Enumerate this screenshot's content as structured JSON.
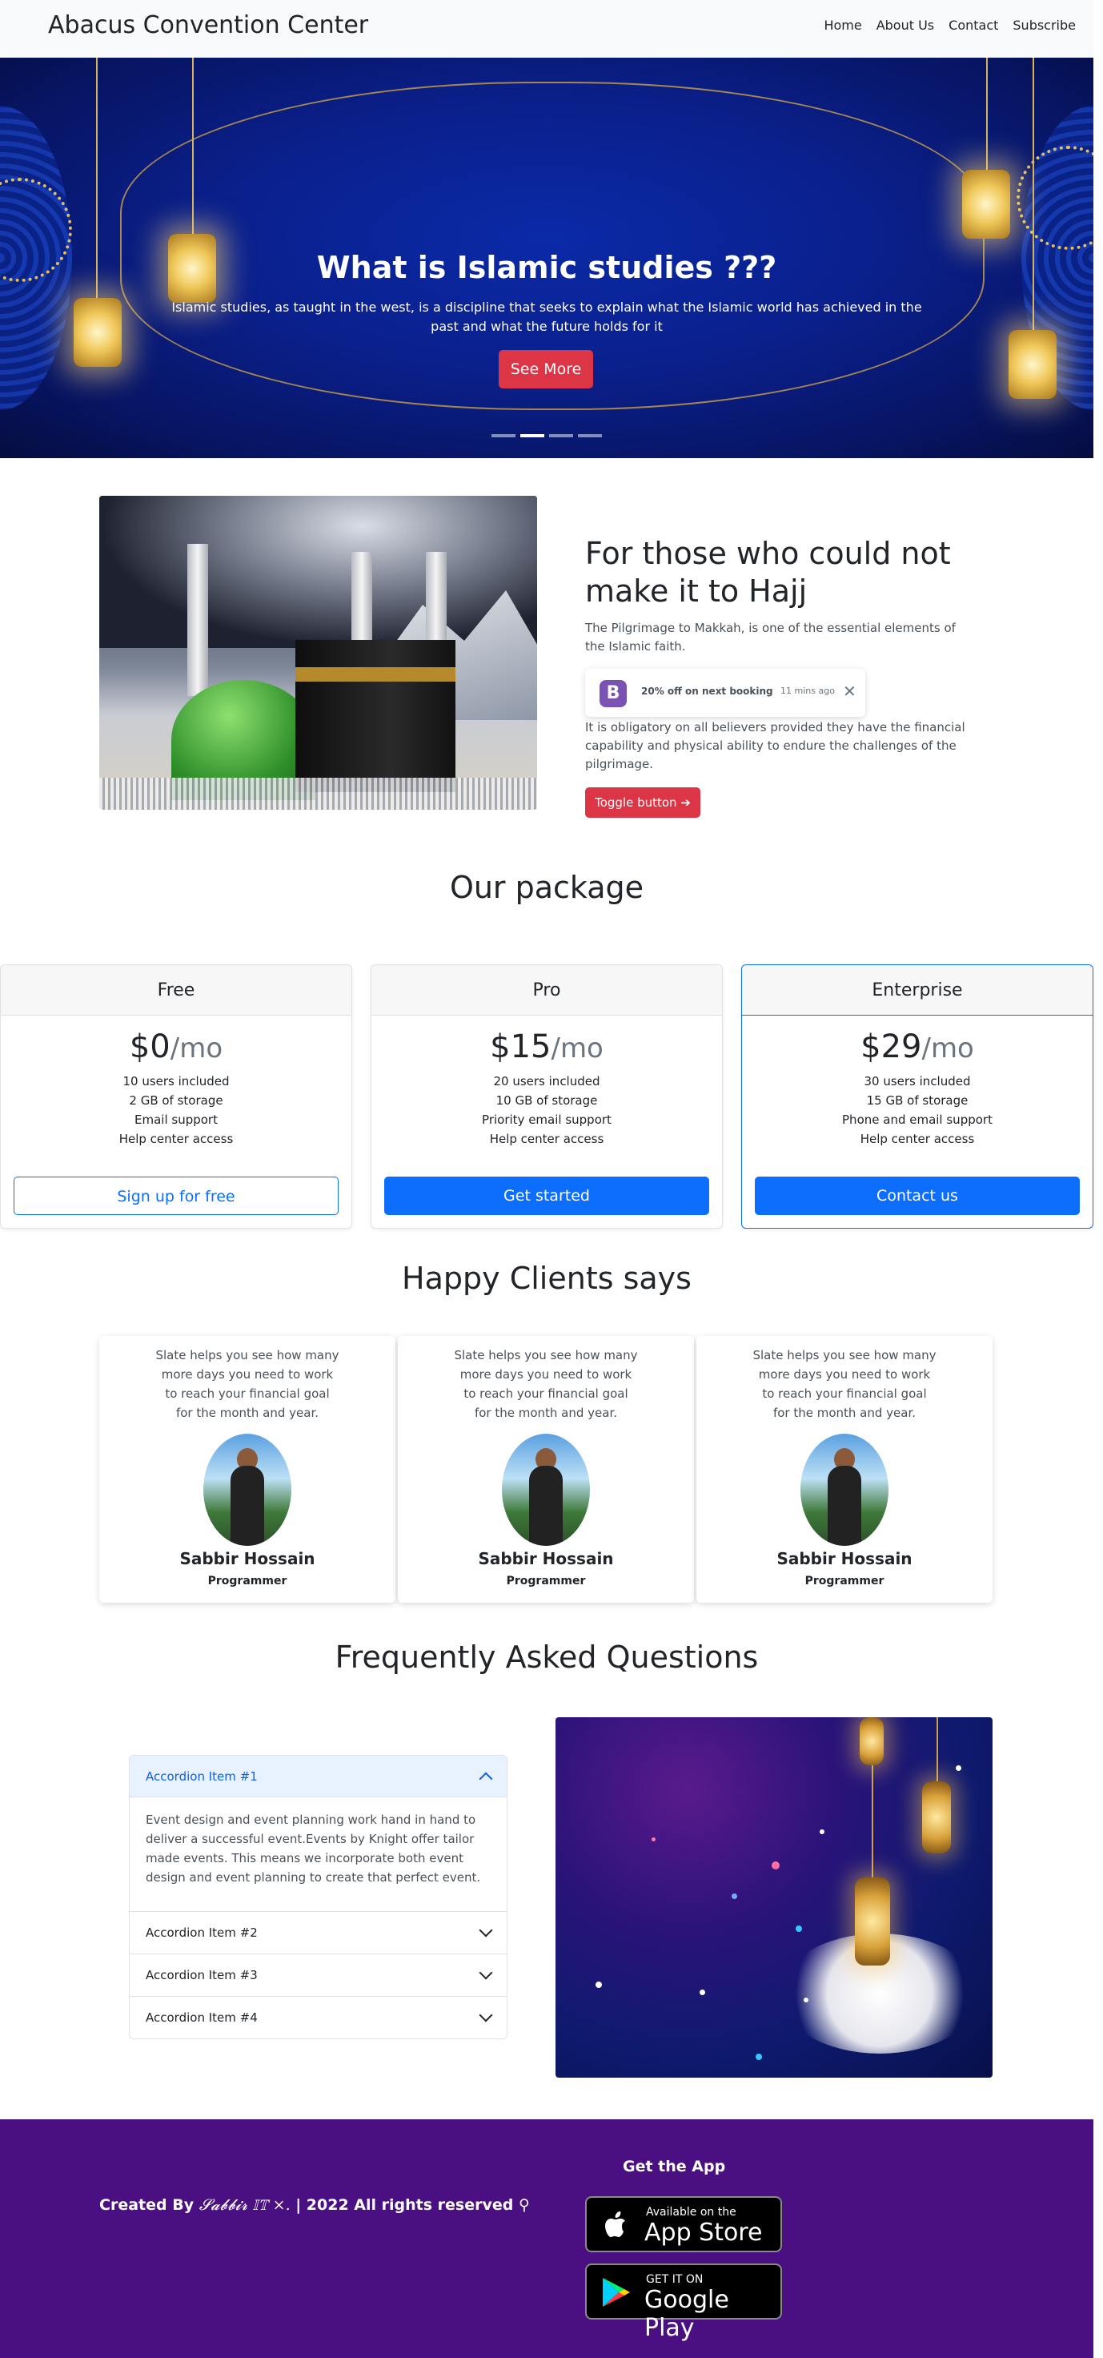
{
  "nav": {
    "brand": "Abacus Convention Center",
    "links": [
      "Home",
      "About Us",
      "Contact",
      "Subscribe"
    ]
  },
  "hero": {
    "title": "What is Islamic studies ???",
    "text": "Islamic studies, as taught in the west, is a discipline that seeks to explain what the Islamic world has achieved in the past and what the future holds for it",
    "button": "See More",
    "slides_total": 4,
    "slide_active": 2
  },
  "hajj": {
    "title": "For those who could not make it to Hajj",
    "p1": "The Pilgrimage to Makkah, is one of the essential elements of the Islamic faith.",
    "toast_logo": "B",
    "toast_text": "20% off on next booking",
    "toast_time": "11 mins ago",
    "toast_close": "✕",
    "p2": "It is obligatory on all believers provided they have the financial capability and physical ability to endure the challenges of the pilgrimage.",
    "button": "Toggle button ➔"
  },
  "packages": {
    "title": "Our package",
    "plans": [
      {
        "name": "Free",
        "price": "$0",
        "per": "/mo",
        "features": [
          "10 users included",
          "2 GB of storage",
          "Email support",
          "Help center access"
        ],
        "button": "Sign up for free"
      },
      {
        "name": "Pro",
        "price": "$15",
        "per": "/mo",
        "features": [
          "20 users included",
          "10 GB of storage",
          "Priority email support",
          "Help center access"
        ],
        "button": "Get started"
      },
      {
        "name": "Enterprise",
        "price": "$29",
        "per": "/mo",
        "features": [
          "30 users included",
          "15 GB of storage",
          "Phone and email support",
          "Help center access"
        ],
        "button": "Contact us"
      }
    ]
  },
  "clients": {
    "title": "Happy Clients says",
    "items": [
      {
        "quote": "Slate helps you see how many more days you need to work to reach your financial goal for the month and year.",
        "name": "Sabbir Hossain",
        "role": "Programmer"
      },
      {
        "quote": "Slate helps you see how many more days you need to work to reach your financial goal for the month and year.",
        "name": "Sabbir Hossain",
        "role": "Programmer"
      },
      {
        "quote": "Slate helps you see how many more days you need to work to reach your financial goal for the month and year.",
        "name": "Sabbir Hossain",
        "role": "Programmer"
      }
    ]
  },
  "faq": {
    "title": "Frequently Asked Questions",
    "items": [
      {
        "label": "Accordion Item #1",
        "body": "Event design and event planning work hand in hand to deliver a successful event.Events by Knight offer tailor made events. This means we incorporate both event design and event planning to create that perfect event."
      },
      {
        "label": "Accordion Item #2"
      },
      {
        "label": "Accordion Item #3"
      },
      {
        "label": "Accordion Item #4"
      }
    ]
  },
  "footer": {
    "created": "Created By ",
    "author": "𝓢𝓪𝓫𝓫𝓲𝓻 𝕀𝕋 ⨯.",
    "rights": " | 2022 All rights reserved ⚲",
    "get_app": "Get the App",
    "appstore_small": "Available on the",
    "appstore_big": "App Store",
    "play_small": "GET IT ON",
    "play_big": "Google Play"
  },
  "colors": {
    "primary": "#0d6efd",
    "danger": "#dc3545",
    "footer_bg": "#4a0f80",
    "hero_bg": "#0a1f8a"
  },
  "icons": [
    "apple-icon",
    "google-play-icon",
    "chevron-up-icon",
    "chevron-down-icon",
    "close-icon",
    "arrow-right-icon"
  ]
}
